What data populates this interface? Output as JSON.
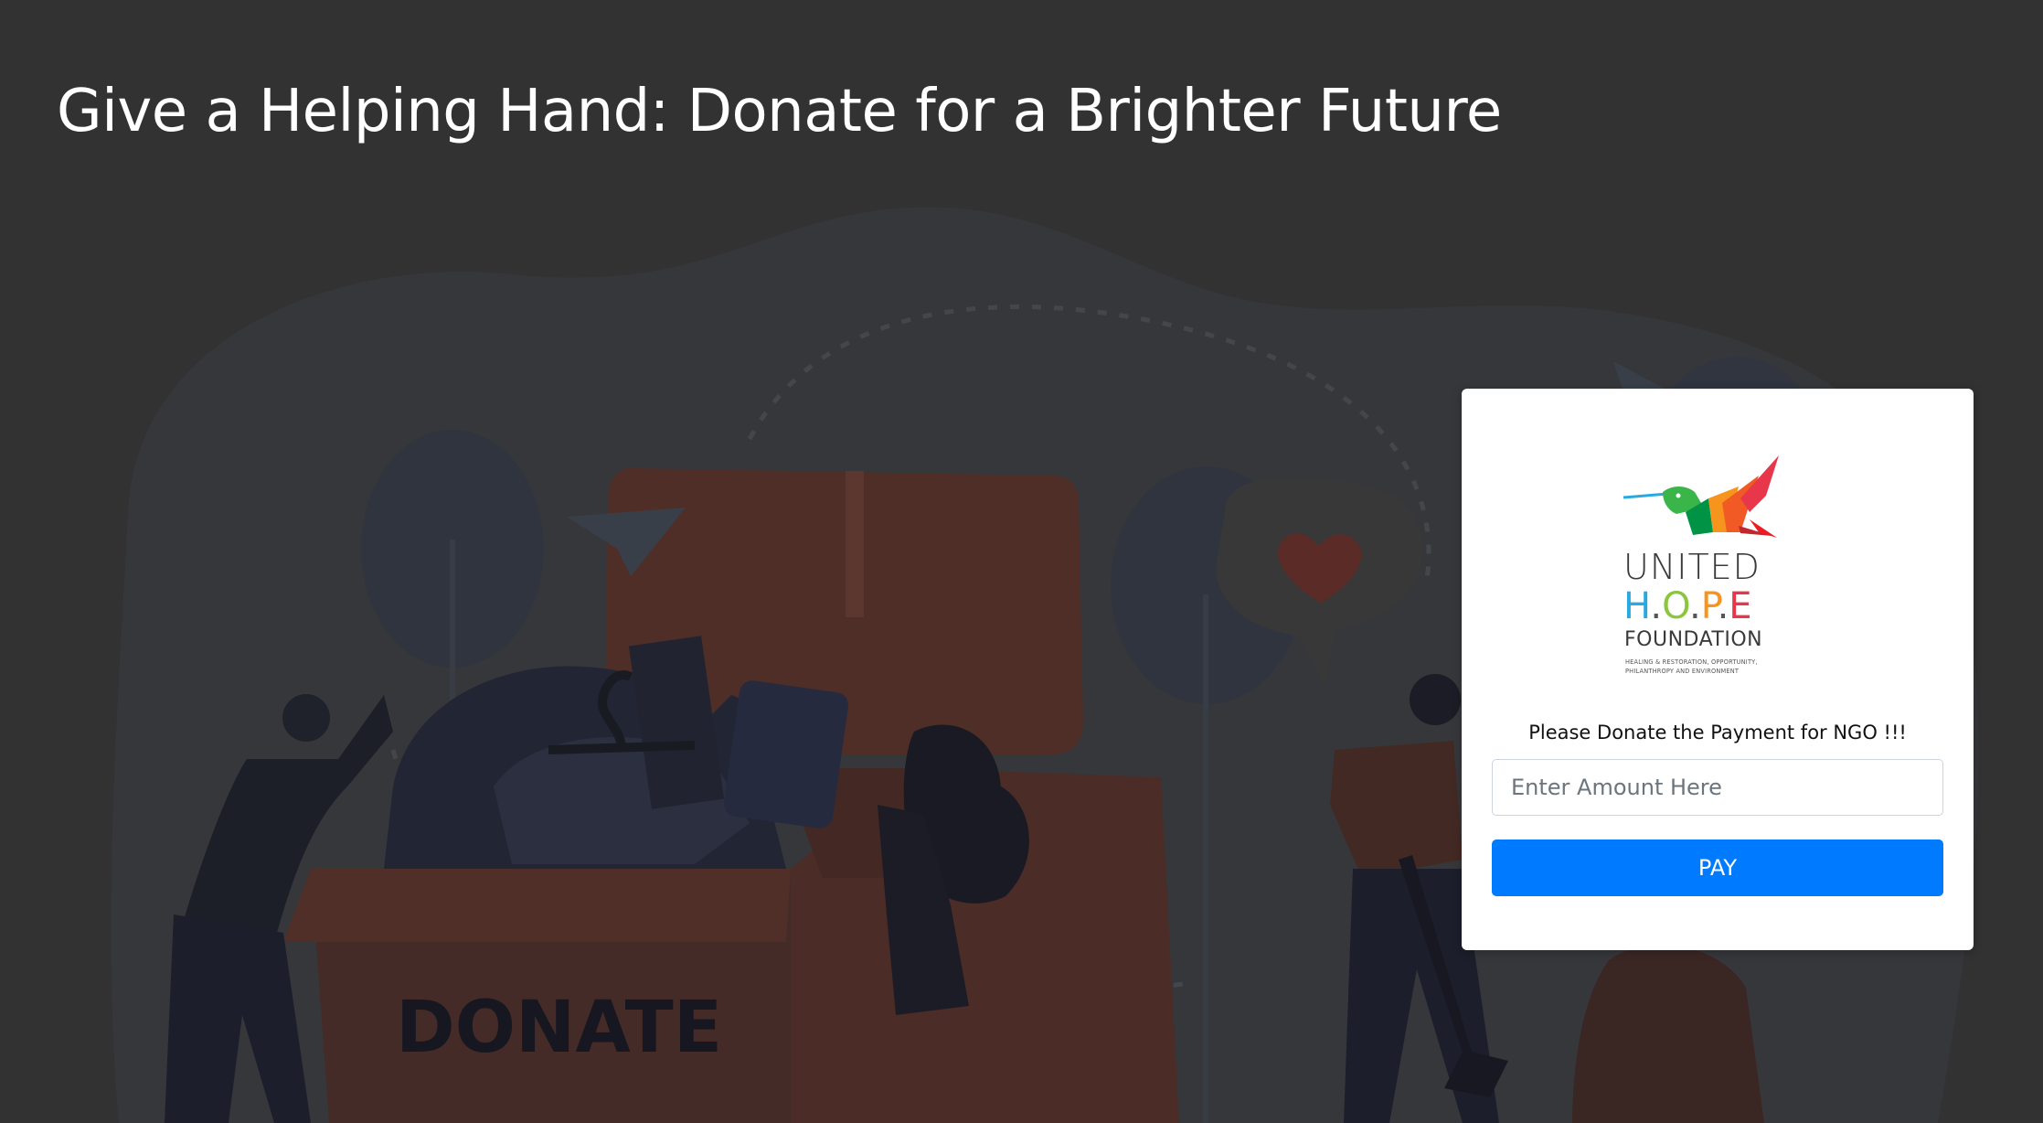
{
  "header": {
    "title": "Give a Helping Hand: Donate for a Brighter Future"
  },
  "illustration": {
    "box_label": "DONATE"
  },
  "donation_card": {
    "logo": {
      "line1": "UNITED",
      "hope_letters": [
        "H",
        ".",
        "O",
        ".",
        "P",
        ".",
        "E"
      ],
      "line3": "FOUNDATION",
      "tagline_line1": "HEALING & RESTORATION, OPPORTUNITY,",
      "tagline_line2": "PHILANTHROPY AND ENVIRONMENT"
    },
    "prompt": "Please Donate the Payment for NGO !!!",
    "amount_input": {
      "value": "",
      "placeholder": "Enter Amount Here"
    },
    "pay_label": "PAY"
  },
  "colors": {
    "page_background": "#333333",
    "pay_button": "#007bff",
    "hope_h": "#29a9e0",
    "hope_o": "#8cc63f",
    "hope_p": "#f7941d",
    "hope_e": "#e8374a"
  }
}
